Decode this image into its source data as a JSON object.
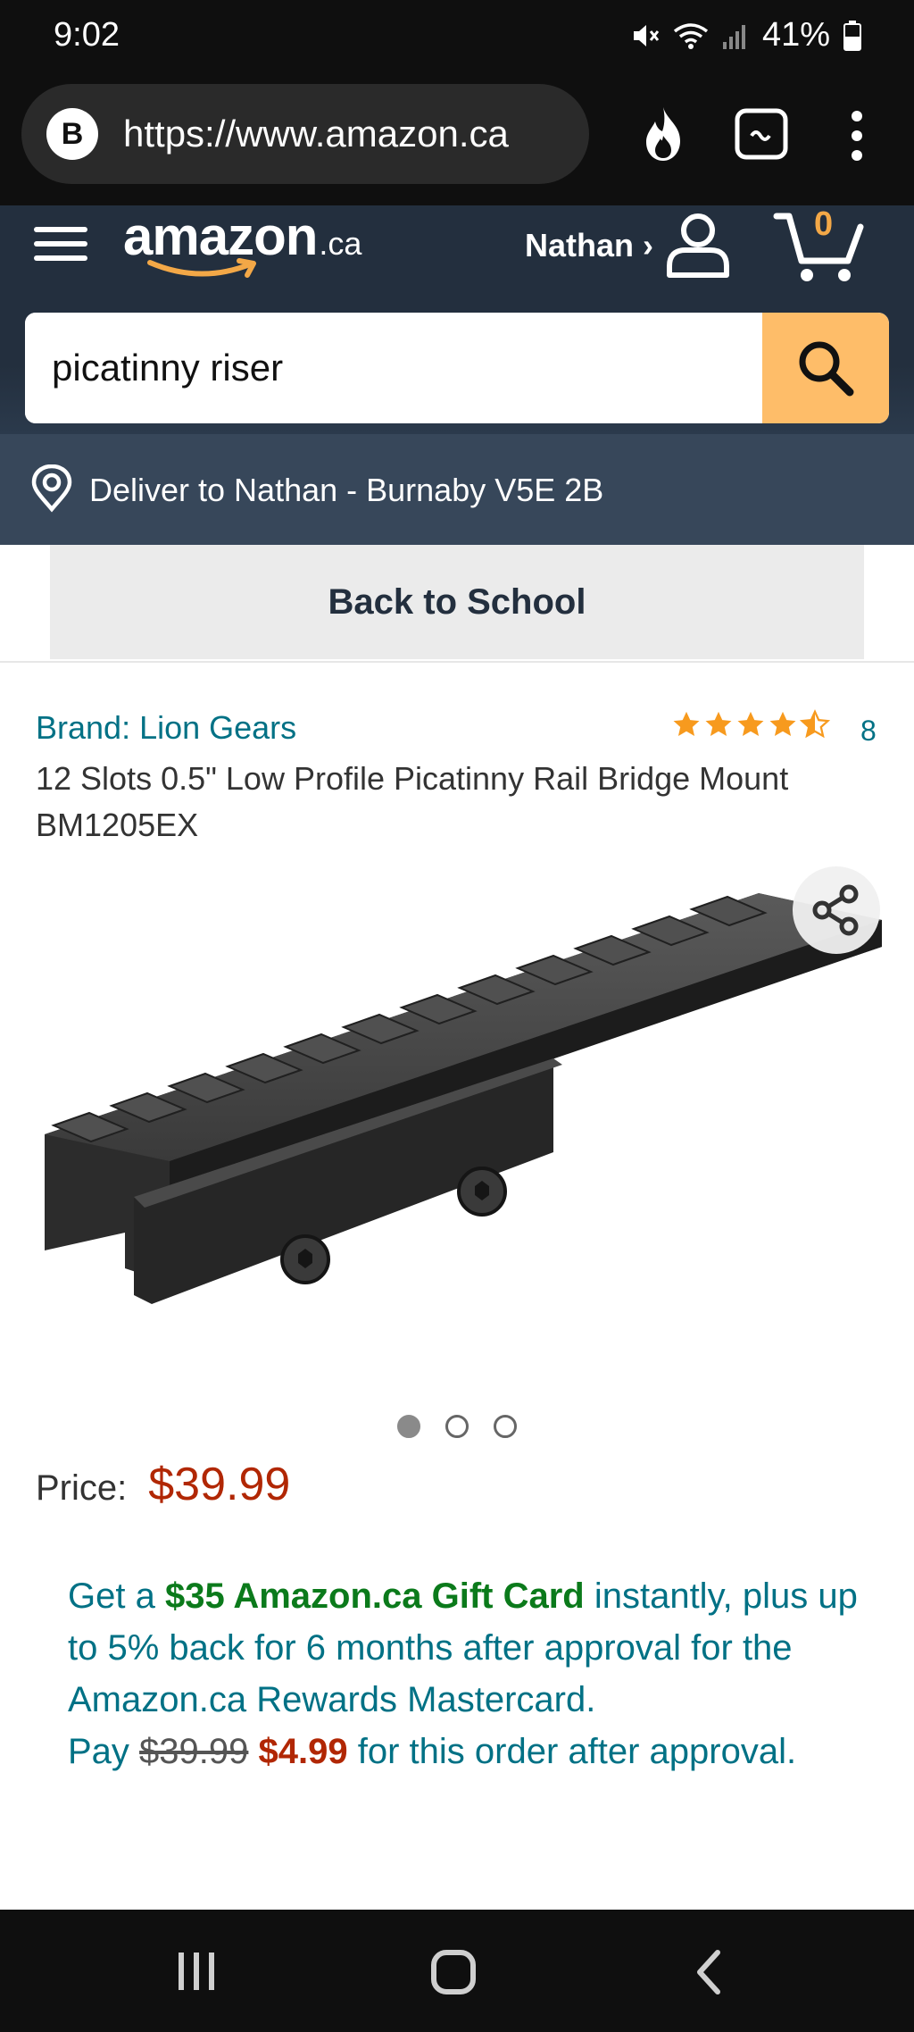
{
  "status_bar": {
    "time": "9:02",
    "battery": "41%"
  },
  "browser": {
    "tab_badge": "B",
    "url": "https://www.amazon.ca"
  },
  "header": {
    "logo_text": "amazon",
    "logo_tld": ".ca",
    "account_label": "Nathan ›",
    "cart_count": "0"
  },
  "search": {
    "value": "picatinny riser"
  },
  "deliver": {
    "text": "Deliver to Nathan - Burnaby V5E 2B"
  },
  "promo": {
    "label": "Back to School"
  },
  "product": {
    "brand": "Brand: Lion Gears",
    "rating": 4.5,
    "rating_count": "8",
    "title": "12 Slots 0.5\" Low Profile Picatinny Rail Bridge Mount BM1205EX",
    "image_count": 3,
    "active_image": 1,
    "price_label": "Price:",
    "price": "$39.99"
  },
  "rewards": {
    "part1": "Get a ",
    "gift_card": "$35 Amazon.ca Gift Card",
    "part2": " instantly, plus up to 5% back for 6 months after approval for the Amazon.ca Rewards Mastercard.",
    "pay_label": "Pay ",
    "old_price": "$39.99",
    "new_price": "$4.99",
    "part3": " for this order after approval."
  },
  "colors": {
    "header_bg": "#232f3e",
    "search_button": "#febd69",
    "link": "#007185",
    "price": "#b12704",
    "gift_card": "#0b7a1b"
  }
}
